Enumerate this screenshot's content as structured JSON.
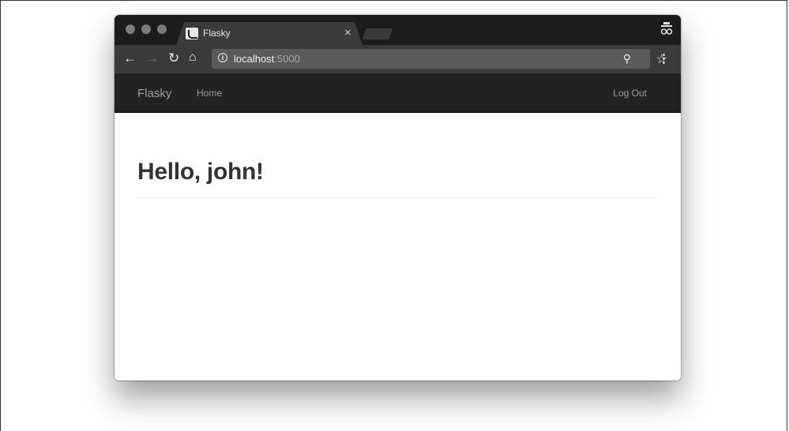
{
  "browser": {
    "tab": {
      "title": "Flasky",
      "close_glyph": "×"
    },
    "address": {
      "host": "localhost",
      "port": ":5000"
    },
    "icons": [
      "back-icon",
      "forward-icon",
      "reload-icon",
      "home-icon",
      "info-icon",
      "zoom-icon",
      "bookmark-star-icon",
      "menu-icon",
      "incognito-icon"
    ]
  },
  "navbar": {
    "brand": "Flasky",
    "links": [
      {
        "label": "Home"
      }
    ],
    "right_link": "Log Out"
  },
  "page": {
    "heading": "Hello, john!"
  },
  "colors": {
    "navbar_bg": "#222222",
    "navbar_text": "#9d9d9d",
    "heading": "#333333"
  }
}
